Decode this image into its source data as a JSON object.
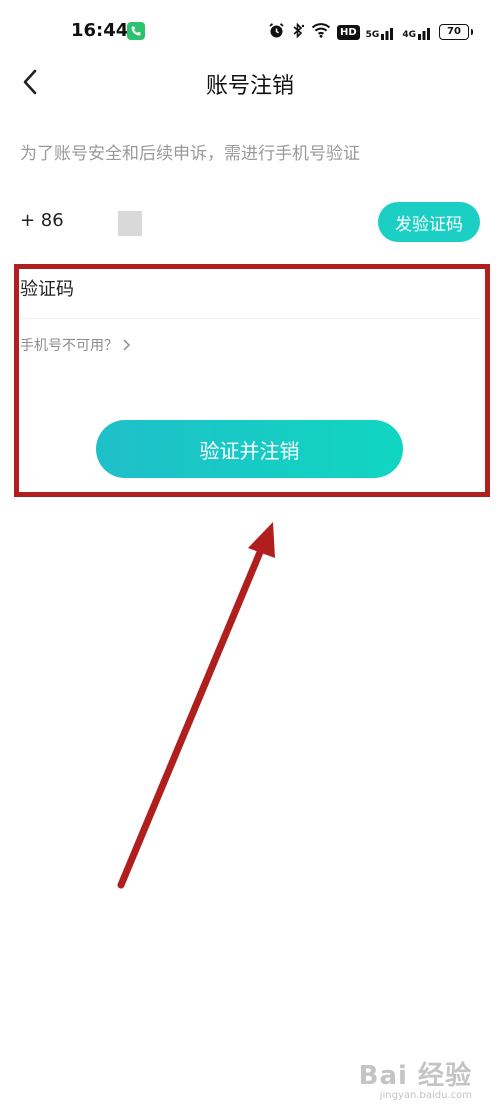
{
  "status_bar": {
    "time": "16:44",
    "network_labels": [
      "5G",
      "4G"
    ],
    "hd_label": "HD",
    "battery": "70"
  },
  "header": {
    "title": "账号注销"
  },
  "hint": "为了账号安全和后续申诉，需进行手机号验证",
  "phone": {
    "country_code": "+ 86"
  },
  "send_code_button": "发验证码",
  "code_field_label": "验证码",
  "phone_unavailable_link": "手机号不可用？",
  "verify_button": "验证并注销",
  "watermark": {
    "brand": "Bai 经验",
    "url": "jingyan.baidu.com"
  },
  "colors": {
    "accent": "#1ccfc4",
    "annotation": "#b01e1e"
  }
}
